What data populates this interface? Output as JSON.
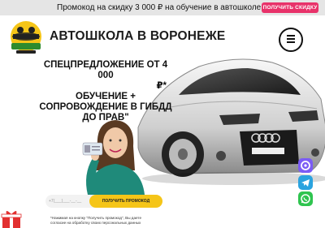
{
  "topbar": {
    "promo_text": "Промокод на скидку 3 000 ₽ на обучение в автошколе",
    "button_label": "ПОЛУЧИТЬ СКИДКУ"
  },
  "header": {
    "title": "АВТОШКОЛА В ВОРОНЕЖЕ",
    "logo_icon": "autoschool-logo"
  },
  "hero": {
    "headline_lines": [
      "СПЕЦПРЕДЛОЖЕНИЕ ОТ 4 000",
      "₽*",
      "ОБУЧЕНИЕ +",
      "СОПРОВОЖДЕНИЕ В ГИБДД",
      "ДО ПРАВ\""
    ]
  },
  "form": {
    "phone_placeholder": "+7(___)___-__-__",
    "button_label": "ПОЛУЧИТЬ ПРОМОКОД",
    "consent_lines": [
      "*Нажимая на кнопку \"Получить промокод\", Вы даете",
      "согласие на обработку своих персональных данных"
    ]
  },
  "side_buttons": [
    {
      "name": "max-messenger-icon",
      "color": "#7b5cf5"
    },
    {
      "name": "telegram-icon",
      "color": "#2aa3df"
    },
    {
      "name": "whatsapp-icon",
      "color": "#2fc44f"
    }
  ],
  "colors": {
    "accent_pink": "#e8326a",
    "accent_yellow": "#f5c518"
  }
}
